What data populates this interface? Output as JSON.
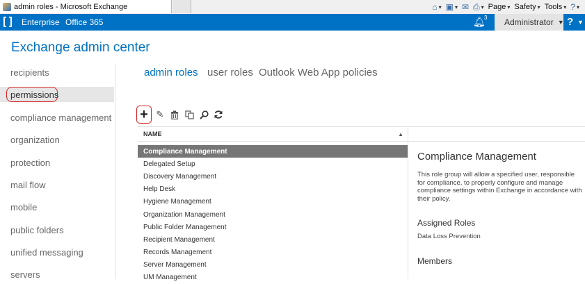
{
  "browser": {
    "tab_title": "admin roles - Microsoft Exchange",
    "commands": [
      "Page",
      "Safety",
      "Tools"
    ]
  },
  "topbar": {
    "enterprise": "Enterprise",
    "office365": "Office 365",
    "notification_count": "3",
    "user": "Administrator",
    "help": "?"
  },
  "app_title": "Exchange admin center",
  "leftnav": {
    "items": [
      "recipients",
      "permissions",
      "compliance management",
      "organization",
      "protection",
      "mail flow",
      "mobile",
      "public folders",
      "unified messaging",
      "servers"
    ],
    "selected": "permissions"
  },
  "subtabs": [
    "admin roles",
    "user roles",
    "Outlook Web App policies"
  ],
  "toolbar": {
    "icons": [
      "add-icon",
      "edit-icon",
      "delete-icon",
      "copy-icon",
      "search-icon",
      "refresh-icon"
    ]
  },
  "list": {
    "header": "NAME",
    "rows": [
      "Compliance Management",
      "Delegated Setup",
      "Discovery Management",
      "Help Desk",
      "Hygiene Management",
      "Organization Management",
      "Public Folder Management",
      "Recipient Management",
      "Records Management",
      "Server Management",
      "UM Management"
    ],
    "selected": "Compliance Management"
  },
  "details": {
    "title": "Compliance Management",
    "description": "This role group will allow a specified user, responsible for compliance, to properly configure and manage compliance settings within Exchange in accordance with their policy.",
    "assigned_roles_heading": "Assigned Roles",
    "assigned_roles": "Data Loss Prevention",
    "members_heading": "Members"
  },
  "colors": {
    "accent": "#0072c6",
    "selected_row": "#767676",
    "highlight_circle": "#d62020"
  }
}
